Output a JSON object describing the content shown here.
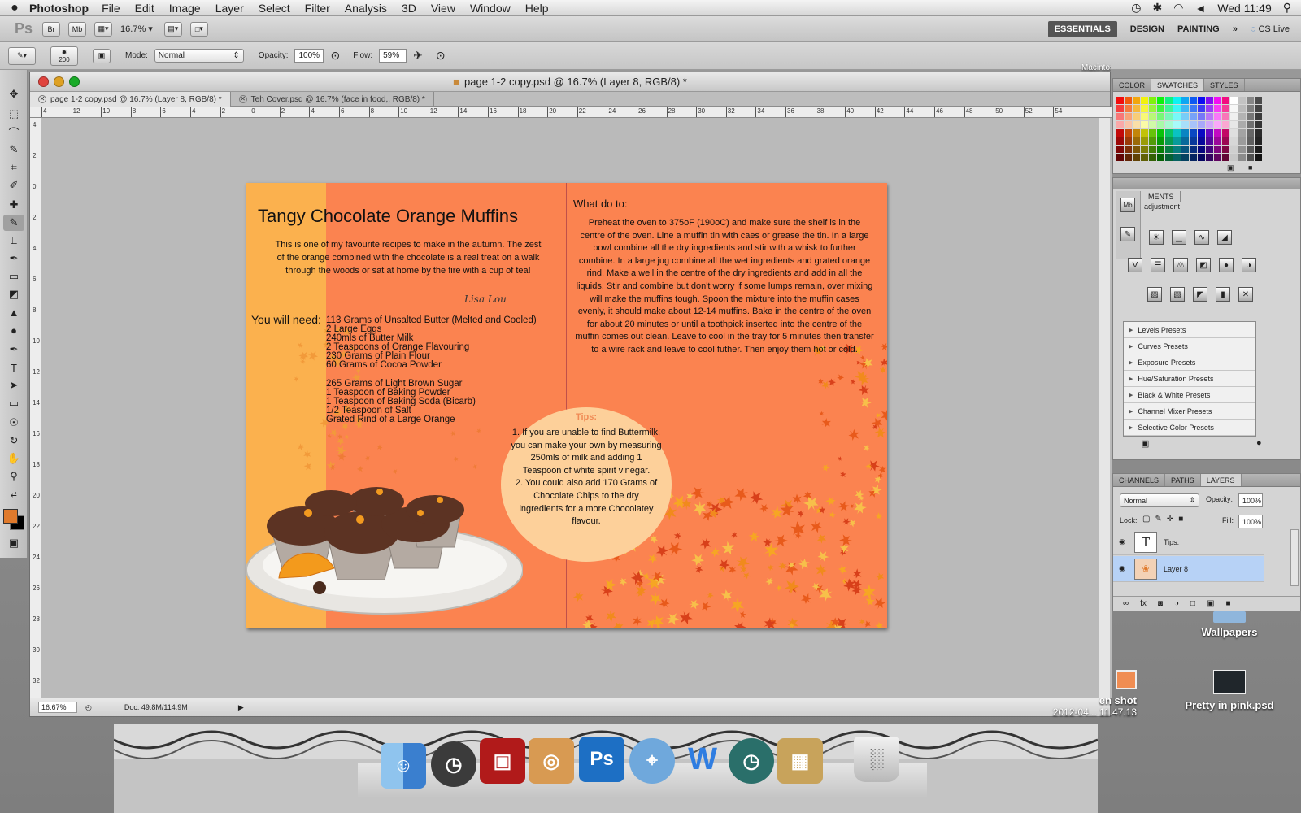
{
  "menubar": {
    "apple": "",
    "app": "Photoshop",
    "items": [
      "File",
      "Edit",
      "Image",
      "Layer",
      "Select",
      "Filter",
      "Analysis",
      "3D",
      "View",
      "Window",
      "Help"
    ],
    "clock": "Wed 11:49"
  },
  "appbar": {
    "ps": "Ps",
    "br": "Br",
    "mb": "Mb",
    "zoom": "16.7%",
    "workspaces": [
      "ESSENTIALS",
      "DESIGN",
      "PAINTING"
    ],
    "more": "»",
    "cslive": "CS Live"
  },
  "options": {
    "brush_size": "200",
    "mode_label": "Mode:",
    "mode_value": "Normal",
    "opacity_label": "Opacity:",
    "opacity_value": "100%",
    "flow_label": "Flow:",
    "flow_value": "59%"
  },
  "document": {
    "window_title": "page 1-2 copy.psd @ 16.7% (Layer 8, RGB/8) *",
    "tabs": [
      "page 1-2 copy.psd @ 16.7% (Layer 8, RGB/8) *",
      "Teh Cover.psd @ 16.7% (face in food,, RGB/8) *"
    ],
    "ruler_top": [
      "4",
      "12",
      "10",
      "8",
      "6",
      "4",
      "2",
      "0",
      "2",
      "4",
      "6",
      "8",
      "10",
      "12",
      "14",
      "16",
      "18",
      "20",
      "22",
      "24",
      "26",
      "28",
      "30",
      "32",
      "34",
      "36",
      "38",
      "40",
      "42",
      "44",
      "46",
      "48",
      "50",
      "52",
      "54"
    ],
    "ruler_left": [
      "4",
      "2",
      "0",
      "2",
      "4",
      "6",
      "8",
      "10",
      "12",
      "14",
      "16",
      "18",
      "20",
      "22",
      "24",
      "26",
      "28",
      "30",
      "32"
    ],
    "status_zoom": "16.67%",
    "status_doc": "Doc: 49.8M/114.9M"
  },
  "artwork": {
    "title": "Tangy Chocolate Orange Muffins",
    "intro": "This is one of my favourite recipes to make in the autumn. The zest of the orange combined with the chocolate is a real treat on a walk through the woods or sat at home by the fire with a cup of tea!",
    "signature": "Lisa Lou",
    "need_label": "You will need:",
    "ingredients_1": [
      "113 Grams of Unsalted Butter (Melted and Cooled)",
      "2 Large Eggs",
      "240mls of Butter Milk",
      "2 Teaspoons of Orange Flavouring",
      "230 Grams of Plain Flour",
      "60 Grams of Cocoa Powder"
    ],
    "ingredients_2": [
      "265 Grams of Light Brown Sugar",
      "1 Teaspoon of Baking Powder",
      "1 Teaspoon of Baking Soda (Bicarb)",
      "1/2 Teaspoon of Salt",
      "Grated Rind of a Large Orange"
    ],
    "what_title": "What do to:",
    "method": "Preheat the oven to 375oF (190oC) and make sure the shelf is in the centre of the oven. Line a muffin tin with caes or grease the tin. In a large bowl combine all the dry ingredients and stir with a whisk to further combine. In a large jug combine all the wet ingredients and grated orange rind. Make a well in the centre of the dry ingredients and add in all the liquids. Stir and combine but don't worry if some lumps remain, over mixing will make the muffins tough. Spoon the mixture into the muffin cases evenly, it should make about 12-14 muffins. Bake in the centre of the oven for about 20 minutes or until a toothpick inserted into the centre of the muffin comes out clean. Leave to cool in the tray for 5 minutes then transfer to a wire rack and leave to cool futher. Then enjoy them hot or cold.",
    "tips_title": "Tips:",
    "tip1": "1. If you are unable to find Buttermilk, you can make your own by measuring 250mls of milk and adding 1 Teaspoon of white spirit vinegar.",
    "tip2": "2. You could also add 170 Grams of Chocolate Chips to the dry ingredients for a more Chocolatey flavour."
  },
  "panels": {
    "color_tabs": [
      "COLOR",
      "SWATCHES",
      "STYLES"
    ],
    "adj_tab": "MENTS",
    "adj_title": "adjustment",
    "presets": [
      "Levels Presets",
      "Curves Presets",
      "Exposure Presets",
      "Hue/Saturation Presets",
      "Black & White Presets",
      "Channel Mixer Presets",
      "Selective Color Presets"
    ],
    "layer_tabs": [
      "CHANNELS",
      "PATHS",
      "LAYERS"
    ],
    "blend_mode": "Normal",
    "opacity_label": "Opacity:",
    "opacity_value": "100%",
    "lock_label": "Lock:",
    "fill_label": "Fill:",
    "fill_value": "100%",
    "layers": [
      {
        "name": "Tips:",
        "kind": "text"
      },
      {
        "name": "Layer 8",
        "kind": "image"
      }
    ]
  },
  "desktop": {
    "icons": [
      "Wallpapers",
      "Pretty in pink.psd"
    ],
    "partial_label_1": "en shot",
    "partial_label_2": "2012-04... 11.47.13",
    "partial_top": "Macintosh"
  },
  "colors": {
    "page_orange": "#fb8350",
    "stripe_orange": "#fbb14e",
    "tips_circle": "#fdd09a",
    "layer_highlight": "#b7d2f6"
  }
}
